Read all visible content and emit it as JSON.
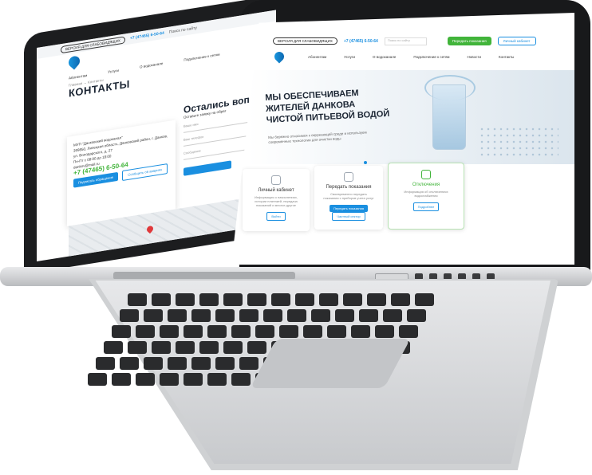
{
  "left_site": {
    "version_button": "ВЕРСИЯ ДЛЯ СЛАБОВИДЯЩИХ",
    "phone": "+7 (47465) 6-50-64",
    "search_placeholder": "Поиск по сайту",
    "nav": [
      "Абонентам",
      "Услуги",
      "О водоканале",
      "Подключение к сетям"
    ],
    "breadcrumb": "Главная → Контакты",
    "title": "КОНТАКТЫ",
    "card": {
      "org": "МУП \"Данковский водоканал\"",
      "address": "399850, Липецкая область, Данковский район, г. Данков, ул. Володарского, д. 27",
      "hours": "Пн-Пт с 08:00 до 18:00",
      "email": "dankov@mail.ru",
      "phone": "+7 (47465) 6-50-64",
      "btn_primary": "Подписать обращение",
      "btn_secondary": "Сообщить об авариях"
    },
    "stay": {
      "heading": "Остались воп",
      "text": "Оставьте заявку на обрат",
      "fields": [
        "Ваше имя",
        "Ваш телефон",
        "Сообщение"
      ]
    }
  },
  "right_site": {
    "version_button": "ВЕРСИЯ ДЛЯ СЛАБОВИДЯЩИХ",
    "phone": "+7 (47465) 6-50-64",
    "search_placeholder": "Поиск по сайту",
    "btn_pay": "Передать показания",
    "btn_account": "Личный кабинет",
    "nav": [
      "Абонентам",
      "Услуги",
      "О водоканале",
      "Подключение к сетям",
      "Новости",
      "Контакты"
    ],
    "hero": {
      "title_lines": [
        "МЫ ОБЕСПЕЧИВАЕМ",
        "ЖИТЕЛЕЙ ДАНКОВА",
        "ЧИСТОЙ ПИТЬЕВОЙ ВОДОЙ"
      ],
      "subtitle": "Мы бережно относимся к окружающей среде и используем современные технологии для очистки воды"
    },
    "cards": [
      {
        "title": "Личный кабинет",
        "desc": "Информация о начислениях, истории платежей, передача показаний и многое другое",
        "btn": "Войти"
      },
      {
        "title": "Передать показания",
        "desc": "Своевременно передать показания с приборов учета услуг",
        "btn": "Передать показания",
        "btn2": "Частный сектор"
      },
      {
        "title": "Отключения",
        "desc": "Информация об отключениях водоснабжения",
        "btn": "Подробнее"
      }
    ]
  }
}
